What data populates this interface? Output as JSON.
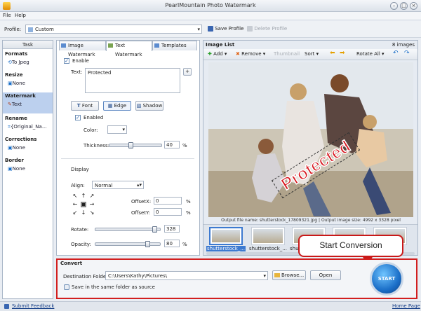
{
  "window": {
    "title": "PearlMountain Photo Watermark"
  },
  "menu": [
    "File",
    "Help"
  ],
  "profile": {
    "label": "Profile:",
    "value": "Custom",
    "save_label": "Save Profile",
    "delete_label": "Delete Profile"
  },
  "task_panel": {
    "header": "Task",
    "sections": [
      {
        "title": "Formats",
        "value": "To Jpeg"
      },
      {
        "title": "Resize",
        "value": "None"
      },
      {
        "title": "Watermark",
        "value": "Text"
      },
      {
        "title": "Rename",
        "value": "{Original_Na..."
      },
      {
        "title": "Corrections",
        "value": "None"
      },
      {
        "title": "Border",
        "value": "None"
      }
    ],
    "selected": "Watermark"
  },
  "tabs": [
    "Image Watermark",
    "Text Watermark",
    "Templates"
  ],
  "active_tab": "Text Watermark",
  "text_watermark": {
    "enable_label": "Enable",
    "enable_checked": true,
    "text_label": "Text:",
    "text_value": "Protected",
    "add_button": "+",
    "font_button": "Font",
    "edge_button": "Edge",
    "shadow_button": "Shadow",
    "edge_enabled_label": "Enabled",
    "edge_enabled_checked": true,
    "color_label": "Color:",
    "thickness_label": "Thickness:",
    "thickness_value": "40",
    "percent": "%",
    "display_label": "Display",
    "align_label": "Align:",
    "align_value": "Normal",
    "offsetx_label": "OffsetX:",
    "offsetx_value": "0",
    "offsety_label": "OffsetY:",
    "offsety_value": "0",
    "rotate_label": "Rotate:",
    "rotate_value": "328",
    "opacity_label": "Opacity:",
    "opacity_value": "80"
  },
  "image_list": {
    "title": "Image List",
    "count": "8 images",
    "toolbar": {
      "add": "Add",
      "remove": "Remove",
      "thumbnail": "Thumbnail",
      "sort": "Sort",
      "rotate_all": "Rotate All"
    },
    "watermark_preview_text": "Protected",
    "info_text": "Output file name: shutterstock_17809321.jpg | Output image size: 4992 x 3328 pixel",
    "thumbnails": [
      "shutterstock_...",
      "shutterstock_...",
      "shutterstock_...",
      "",
      ""
    ]
  },
  "convert": {
    "header": "Convert",
    "dest_label": "Destination Folder:",
    "dest_value": "C:\\Users\\Kathy\\Pictures\\",
    "browse_label": "Browse...",
    "open_label": "Open",
    "same_folder_label": "Save in the same folder as source",
    "start_label": "START"
  },
  "callout": {
    "text": "Start Conversion"
  },
  "status": {
    "feedback": "Submit Feedback",
    "home": "Home Page"
  },
  "colors": {
    "accent": "#1b6fc8",
    "selected_task": "#bcd0ee",
    "callout_border": "#c91818",
    "watermark_text": "#d8171f"
  }
}
